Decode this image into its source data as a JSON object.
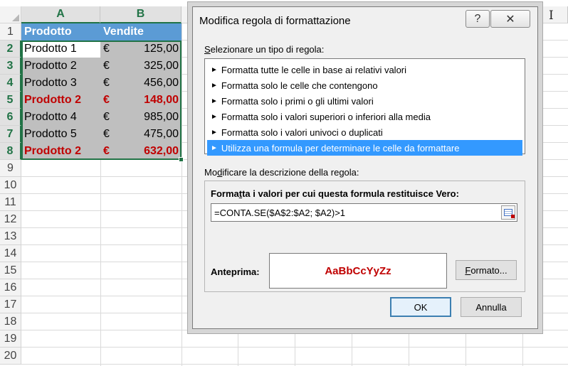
{
  "sheet": {
    "columns": [
      "A",
      "B"
    ],
    "rows": [
      "1",
      "2",
      "3",
      "4",
      "5",
      "6",
      "7",
      "8",
      "9",
      "10",
      "11",
      "12",
      "13",
      "14",
      "15",
      "16",
      "17",
      "18",
      "19",
      "20"
    ],
    "header": {
      "col_a": "Prodotto",
      "col_b": "Vendite"
    },
    "data": [
      {
        "product": "Prodotto 1",
        "currency": "€",
        "amount": "125,00",
        "duplicate": false
      },
      {
        "product": "Prodotto 2",
        "currency": "€",
        "amount": "325,00",
        "duplicate": false
      },
      {
        "product": "Prodotto 3",
        "currency": "€",
        "amount": "456,00",
        "duplicate": false
      },
      {
        "product": "Prodotto 2",
        "currency": "€",
        "amount": "148,00",
        "duplicate": true
      },
      {
        "product": "Prodotto 4",
        "currency": "€",
        "amount": "985,00",
        "duplicate": false
      },
      {
        "product": "Prodotto 5",
        "currency": "€",
        "amount": "475,00",
        "duplicate": false
      },
      {
        "product": "Prodotto 2",
        "currency": "€",
        "amount": "632,00",
        "duplicate": true
      }
    ],
    "colors": {
      "header_fill": "#5b9bd5",
      "gray_fill": "#bfbfbf",
      "highlight_text": "#c00000",
      "selection": "#217346"
    }
  },
  "dialog": {
    "title": "Modifica regola di formattazione",
    "help_glyph": "?",
    "close_glyph": "✕",
    "select_type_label_pre": "",
    "select_type_label_u": "S",
    "select_type_label_post": "elezionare un tipo di regola:",
    "rule_types": [
      "Formatta tutte le celle in base ai relativi valori",
      "Formatta solo le celle che contengono",
      "Formatta solo i primi o gli ultimi valori",
      "Formatta solo i valori superiori o inferiori alla media",
      "Formatta solo i valori univoci o duplicati",
      "Utilizza una formula per determinare le celle da formattare"
    ],
    "selected_rule_index": 5,
    "edit_desc_label_pre": "Mo",
    "edit_desc_label_u": "d",
    "edit_desc_label_post": "ificare la descrizione della regola:",
    "formula_label_pre": "Forma",
    "formula_label_u": "t",
    "formula_label_post": "ta i valori per cui questa formula restituisce Vero:",
    "formula_value": "=CONTA.SE($A$2:$A2; $A2)>1",
    "preview_label": "Anteprima:",
    "preview_text": "AaBbCcYyZz",
    "format_button_u": "F",
    "format_button_post": "ormato...",
    "ok_label": "OK",
    "cancel_label": "Annulla"
  },
  "cursor_glyph": "I"
}
